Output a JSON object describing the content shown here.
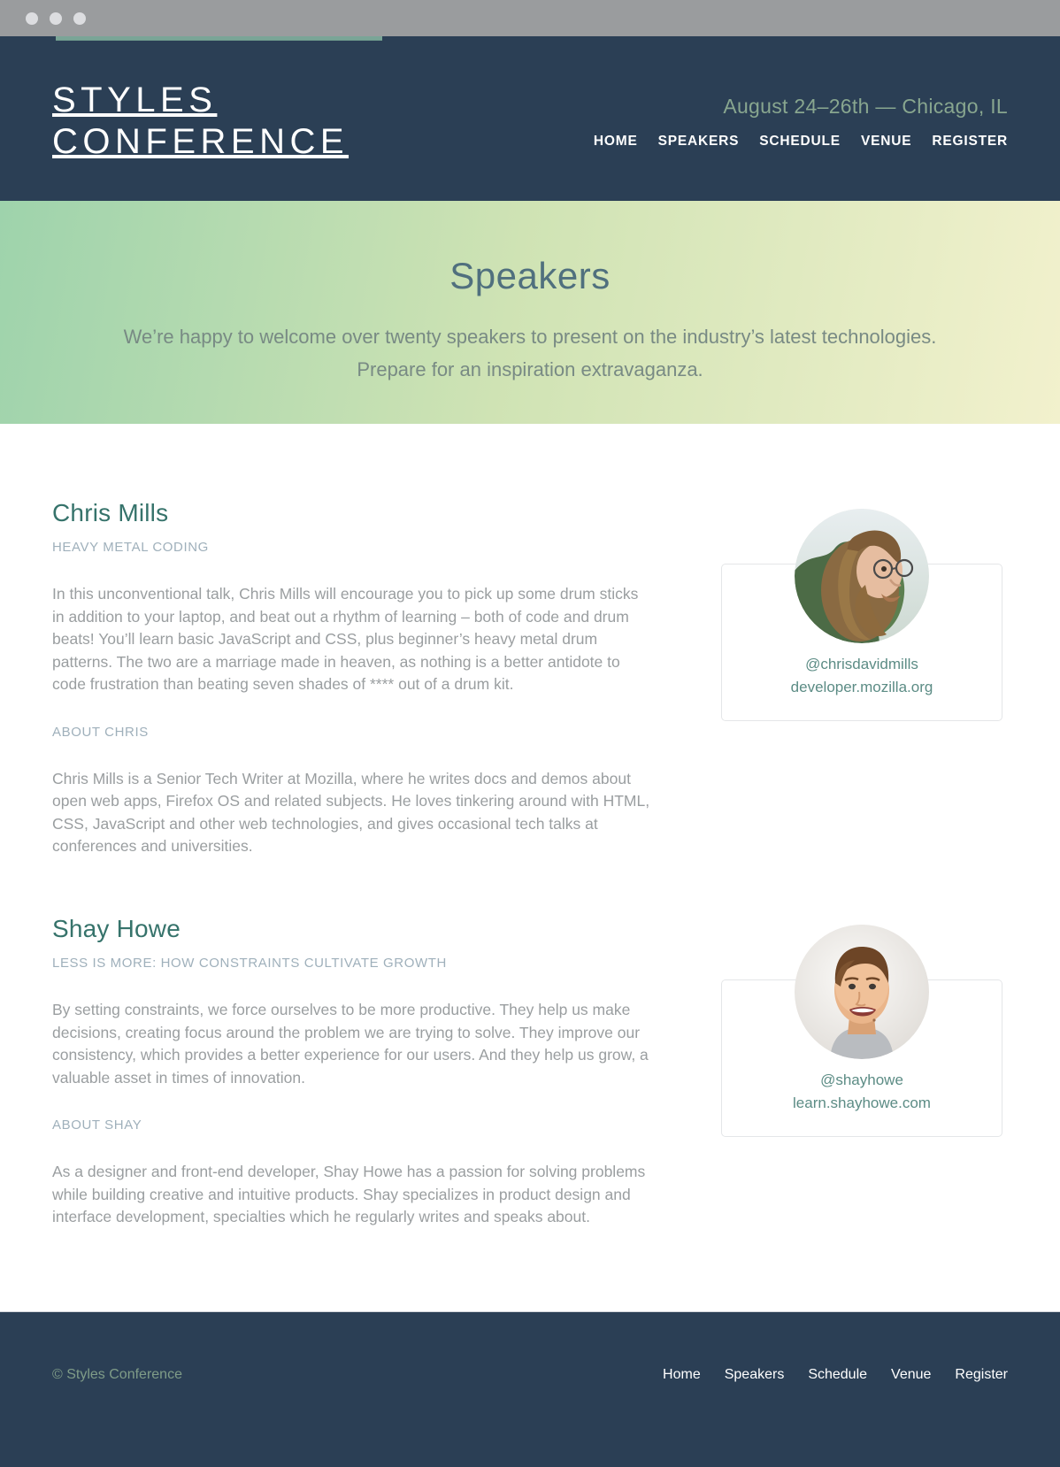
{
  "browser": {
    "traffic_lights": [
      "close",
      "minimize",
      "zoom"
    ],
    "page_load_progress": 34
  },
  "colors": {
    "header_bg": "#2b3f55",
    "accent_green": "#7aa597",
    "speaker_name": "#36736b",
    "label_gray": "#9fb0bb",
    "body_gray": "#9a9ea0",
    "link_green": "#5c8c85",
    "hero_gradient_start": "#9ed3ac",
    "hero_gradient_end": "#f2f1cd"
  },
  "header": {
    "logo": "Styles\nConference",
    "tagline": "August 24–26th — Chicago, IL",
    "nav": [
      {
        "label": "Home"
      },
      {
        "label": "Speakers"
      },
      {
        "label": "Schedule"
      },
      {
        "label": "Venue"
      },
      {
        "label": "Register"
      }
    ]
  },
  "hero": {
    "title": "Speakers",
    "subtitle": "We’re happy to welcome over twenty speakers to present on the industry’s latest technologies. Prepare for an inspiration extravaganza."
  },
  "speakers": [
    {
      "name": "Chris Mills",
      "talk_title": "Heavy Metal Coding",
      "talk_description": "In this unconventional talk, Chris Mills will encourage you to pick up some drum sticks in addition to your laptop, and beat out a rhythm of learning – both of code and drum beats! You’ll learn basic JavaScript and CSS, plus beginner’s heavy metal drum patterns. The two are a marriage made in heaven, as nothing is a better antidote to code frustration than beating seven shades of **** out of a drum kit.",
      "about_label": "About Chris",
      "about_text": "Chris Mills is a Senior Tech Writer at Mozilla, where he writes docs and demos about open web apps, Firefox OS and related subjects. He loves tinkering around with HTML, CSS, JavaScript and other web technologies, and gives occasional tech talks at conferences and universities.",
      "handle": "@chrisdavidmills",
      "website": "developer.mozilla.org",
      "avatar": "chris-mills-portrait"
    },
    {
      "name": "Shay Howe",
      "talk_title": "Less Is More: How Constraints Cultivate Growth",
      "talk_description": "By setting constraints, we force ourselves to be more productive. They help us make decisions, creating focus around the problem we are trying to solve. They improve our consistency, which provides a better experience for our users. And they help us grow, a valuable asset in times of innovation.",
      "about_label": "About Shay",
      "about_text": "As a designer and front-end developer, Shay Howe has a passion for solving problems while building creative and intuitive products. Shay specializes in product design and interface development, specialties which he regularly writes and speaks about.",
      "handle": "@shayhowe",
      "website": "learn.shayhowe.com",
      "avatar": "shay-howe-portrait"
    }
  ],
  "footer": {
    "copyright": "© Styles Conference",
    "nav": [
      {
        "label": "Home"
      },
      {
        "label": "Speakers"
      },
      {
        "label": "Schedule"
      },
      {
        "label": "Venue"
      },
      {
        "label": "Register"
      }
    ]
  }
}
